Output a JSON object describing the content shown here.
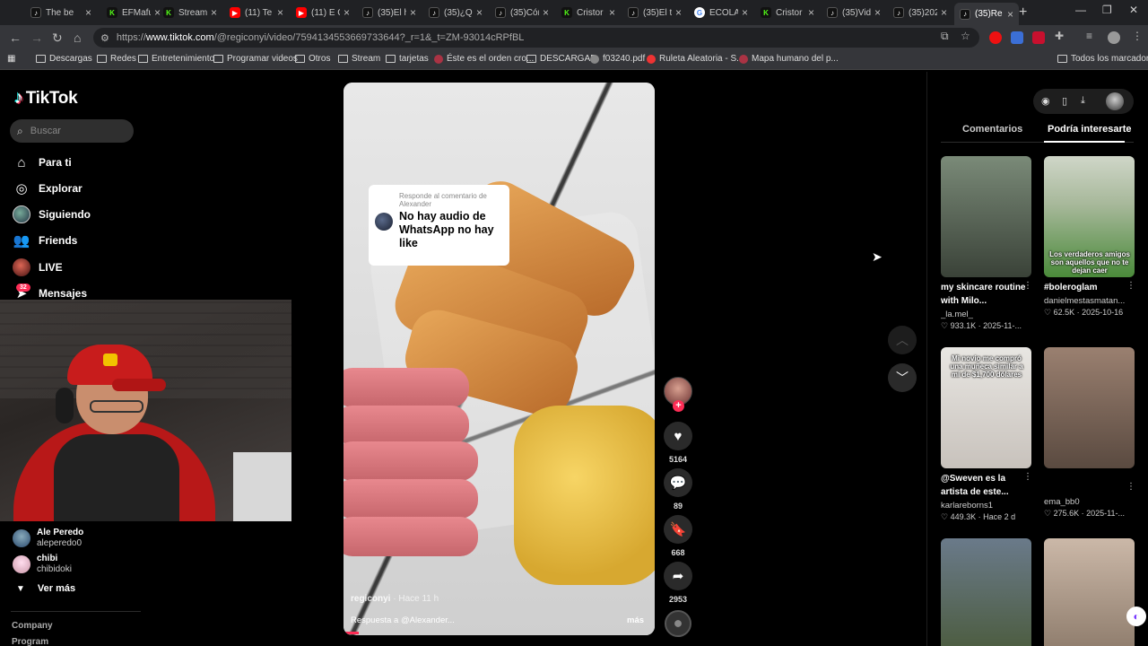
{
  "browser": {
    "tabs": [
      {
        "title": "The be",
        "icon": "tiktok"
      },
      {
        "title": "EFMafu",
        "icon": "kick"
      },
      {
        "title": "Stream",
        "icon": "kick"
      },
      {
        "title": "(11) Te",
        "icon": "youtube"
      },
      {
        "title": "(11) E C",
        "icon": "youtube"
      },
      {
        "title": "(35)El h",
        "icon": "tiktok"
      },
      {
        "title": "(35)¿Q",
        "icon": "tiktok"
      },
      {
        "title": "(35)Cór",
        "icon": "tiktok"
      },
      {
        "title": "Cristor",
        "icon": "kick"
      },
      {
        "title": "(35)El t",
        "icon": "tiktok"
      },
      {
        "title": "ECOLA",
        "icon": "google"
      },
      {
        "title": "Cristor",
        "icon": "kick"
      },
      {
        "title": "(35)Vid",
        "icon": "tiktok"
      },
      {
        "title": "(35)202",
        "icon": "tiktok"
      },
      {
        "title": "(35)Re",
        "icon": "tiktok",
        "active": true
      }
    ],
    "url_prefix": "https://",
    "url_host": "www.tiktok.com",
    "url_path": "/@regiconyi/video/7594134553669733644?_r=1&_t=ZM-93014cRPfBL",
    "bookmarks": [
      {
        "label": "Descargas",
        "type": "folder"
      },
      {
        "label": "Redes",
        "type": "folder"
      },
      {
        "label": "Entretenimiento",
        "type": "folder"
      },
      {
        "label": "Programar videos",
        "type": "folder"
      },
      {
        "label": "Otros",
        "type": "folder"
      },
      {
        "label": "Stream",
        "type": "folder"
      },
      {
        "label": "tarjetas",
        "type": "folder"
      },
      {
        "label": "Éste es el orden cro...",
        "type": "page"
      },
      {
        "label": "DESCARGAR",
        "type": "folder"
      },
      {
        "label": "f03240.pdf",
        "type": "page"
      },
      {
        "label": "Ruleta Aleatoria - S...",
        "type": "page"
      },
      {
        "label": "Mapa humano del p...",
        "type": "page"
      }
    ],
    "all_bookmarks": "Todos los marcadores"
  },
  "sidebar": {
    "brand": "TikTok",
    "search_placeholder": "Buscar",
    "menu": [
      {
        "label": "Para ti",
        "icon": "home-icon"
      },
      {
        "label": "Explorar",
        "icon": "compass-icon"
      },
      {
        "label": "Siguiendo",
        "icon": "avatar"
      },
      {
        "label": "Friends",
        "icon": "friends-icon"
      },
      {
        "label": "LIVE",
        "icon": "live-avatar"
      },
      {
        "label": "Mensajes",
        "icon": "send-icon"
      }
    ],
    "messages_badge": "32",
    "following": [
      {
        "name": "Ale Peredo",
        "handle": "aleperedo0",
        "color": "#2b4a6e"
      },
      {
        "name": "chibi",
        "handle": "chibidoki",
        "color": "#e7c0d6"
      }
    ],
    "see_more": "Ver más",
    "footer": [
      "Company",
      "Program"
    ]
  },
  "video": {
    "reply_label": "Responde al comentario de Alexander",
    "reply_text": "No hay audio de WhatsApp no hay like",
    "author": "regiconyi",
    "time": "· Hace 11 h",
    "caption": "Respuesta a @Alexander...",
    "more": "más",
    "progress": 0.05,
    "likes": "5164",
    "comments": "89",
    "saves": "668",
    "shares": "2953"
  },
  "panel": {
    "tabs": [
      "Comentarios",
      "Podría interesarte"
    ],
    "active_tab": 1,
    "cards": [
      {
        "caption": "my skincare routine with Milo...",
        "author": "_la.mel_",
        "stats": "933.1K · 2025-11-...",
        "thumb_text": "",
        "bg": "linear-gradient(180deg,#7a8a78,#3a4238)"
      },
      {
        "caption": "#boleroglam",
        "author": "danielmestasmatan...",
        "stats": "62.5K · 2025-10-16",
        "thumb_text": "Los verdaderos amigos son aquellos que no te dejan caer",
        "bg": "linear-gradient(180deg,#cfd6c8 0%,#a7b89a 40%,#4a8a3a 100%)"
      },
      {
        "caption": "@Sweven es la artista de este...",
        "author": "karlareborns1",
        "stats": "449.3K · Hace 2 d",
        "thumb_text": "Mi novio me compró una muñeca similar a mí de $1,700 dólares",
        "bg": "linear-gradient(180deg,#e8e6e2,#c8c2bc)"
      },
      {
        "caption": "",
        "author": "ema_bb0",
        "stats": "275.6K · 2025-11-...",
        "thumb_text": "",
        "bg": "linear-gradient(180deg,#9a8070,#5a4a40)"
      },
      {
        "caption": "",
        "author": "",
        "stats": "",
        "thumb_text": "",
        "bg": "linear-gradient(180deg,#6a7a8a,#4a5a3a)"
      },
      {
        "caption": "",
        "author": "",
        "stats": "",
        "thumb_text": "",
        "bg": "linear-gradient(180deg,#cbb8a8,#8a7868)"
      }
    ]
  }
}
